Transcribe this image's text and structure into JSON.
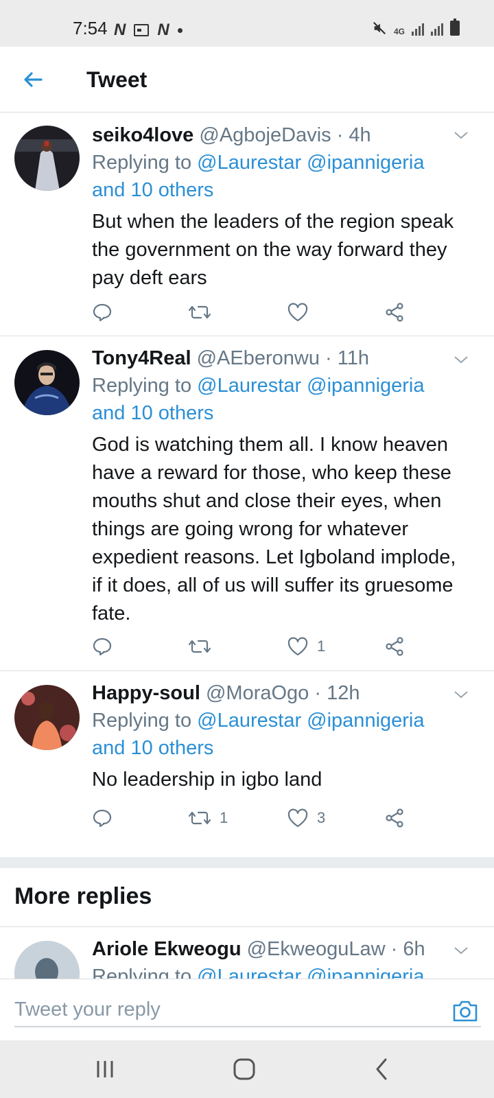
{
  "status_bar": {
    "time": "7:54",
    "network": "4G"
  },
  "header": {
    "title": "Tweet"
  },
  "tweets": [
    {
      "name": "seiko4love",
      "handle": "@AgbojeDavis",
      "time": "· 4h",
      "replying_prefix": "Replying to ",
      "mention1": "@Laurestar",
      "mention2": "@ipannigeria",
      "others": "and 10 others",
      "text": "But when the leaders of the region speak the government on the way forward they pay deft ears",
      "retweets": "",
      "likes": ""
    },
    {
      "name": "Tony4Real",
      "handle": "@AEberonwu",
      "time": "· 11h",
      "replying_prefix": "Replying to ",
      "mention1": "@Laurestar",
      "mention2": "@ipannigeria",
      "others": "and 10 others",
      "text": "God is watching them all. I know heaven have a reward for those, who keep these mouths shut and close their eyes, when things are going wrong for whatever expedient reasons. Let Igboland implode, if it does, all of us will suffer its gruesome fate.",
      "retweets": "",
      "likes": "1"
    },
    {
      "name": "Happy-soul",
      "handle": "@MoraOgo",
      "time": "· 12h",
      "replying_prefix": "Replying to ",
      "mention1": "@Laurestar",
      "mention2": "@ipannigeria",
      "others": "and 10 others",
      "text": "No leadership in igbo land",
      "retweets": "1",
      "likes": "3"
    }
  ],
  "more_replies": {
    "title": "More replies",
    "tweet": {
      "name": "Ariole Ekweogu",
      "handle": "@EkweoguLaw",
      "time": "· 6h",
      "replying_prefix": "Replying to ",
      "mention1": "@Laurestar",
      "mention2": "@ipannigeria"
    }
  },
  "reply_bar": {
    "placeholder": "Tweet your reply"
  },
  "icons": {
    "back": "arrow-left-icon",
    "caret": "chevron-down-icon",
    "reply": "reply-icon",
    "retweet": "retweet-icon",
    "like": "heart-icon",
    "share": "share-icon",
    "camera": "camera-icon"
  },
  "colors": {
    "accent": "#2a8fd6",
    "secondary_text": "#657786",
    "divider": "#dadde0"
  }
}
